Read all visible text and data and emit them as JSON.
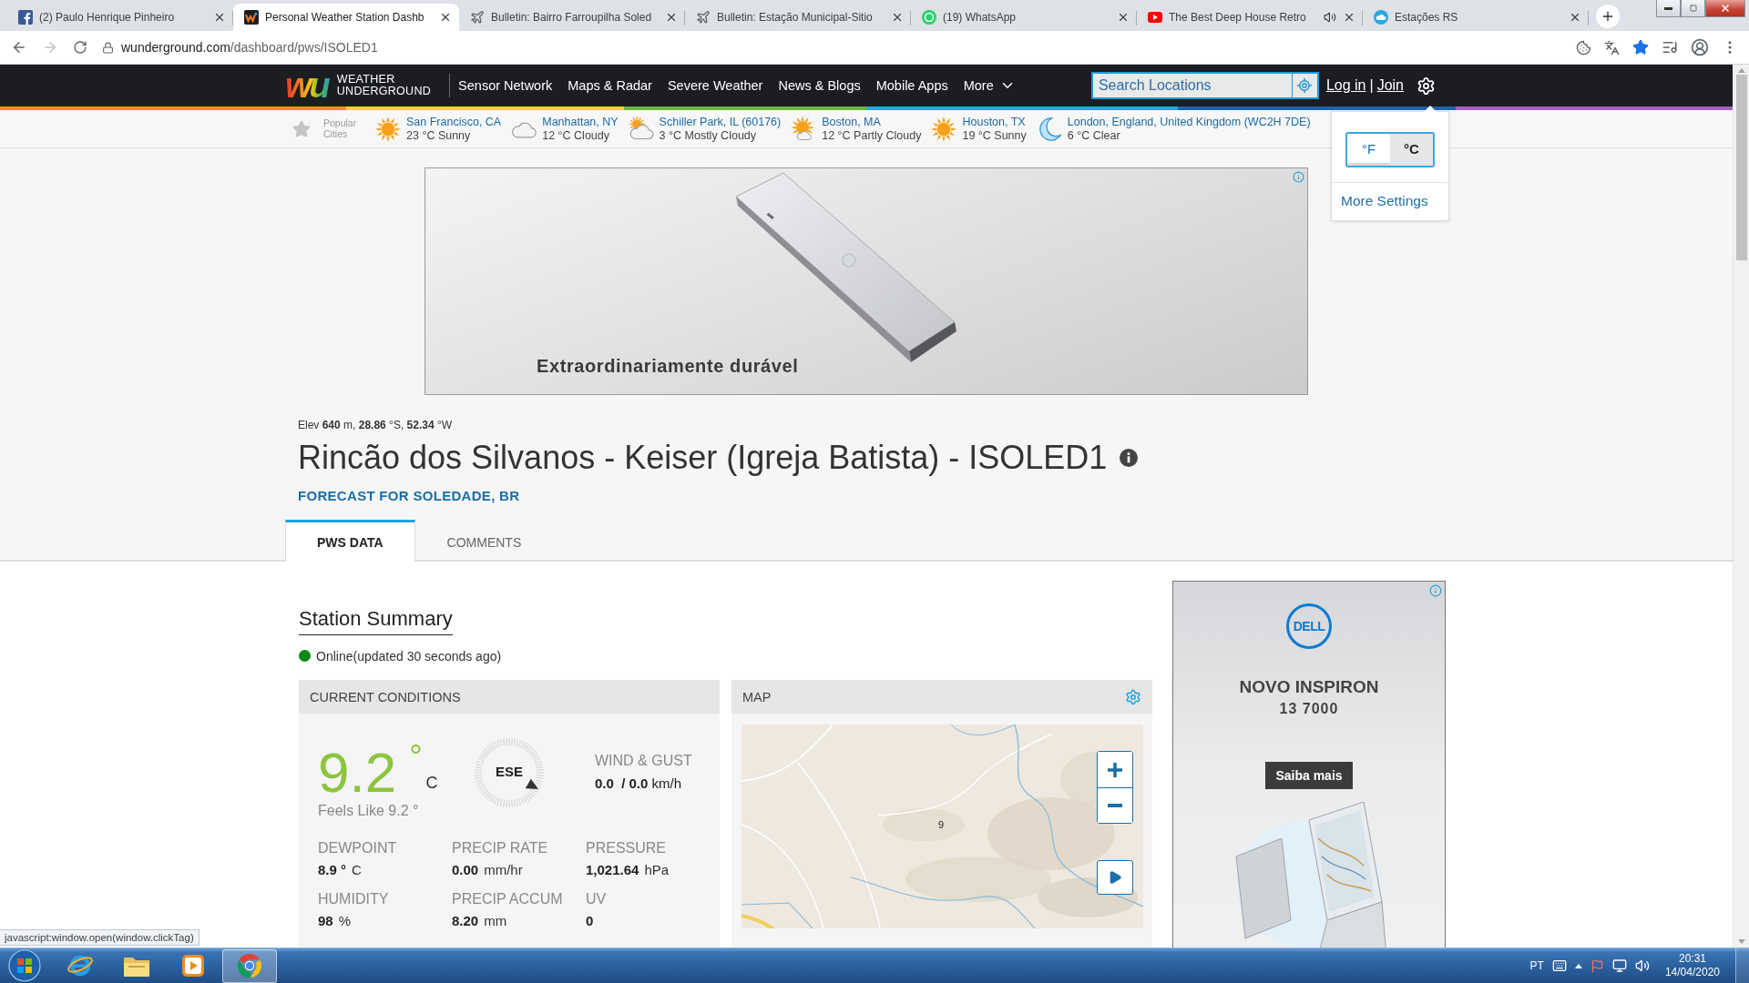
{
  "browser": {
    "tabs": [
      {
        "title": "(2) Paulo Henrique Pinheiro",
        "kind": "facebook",
        "audio": false,
        "selected": false
      },
      {
        "title": "Personal Weather Station Dashb",
        "kind": "wu",
        "audio": false,
        "selected": true
      },
      {
        "title": "Bulletin: Bairro Farroupilha Soled",
        "kind": "plane",
        "audio": false,
        "selected": false
      },
      {
        "title": "Bulletin: Estação Municipal-Sitio",
        "kind": "plane",
        "audio": false,
        "selected": false
      },
      {
        "title": "(19) WhatsApp",
        "kind": "whatsapp",
        "audio": false,
        "selected": false
      },
      {
        "title": "The Best Deep House Retro",
        "kind": "youtube",
        "audio": true,
        "selected": false
      },
      {
        "title": "Estações RS",
        "kind": "cloud",
        "audio": false,
        "selected": false
      }
    ],
    "url": {
      "host": "wunderground.com",
      "path": "/dashboard/pws/ISOLED1"
    }
  },
  "site_header": {
    "logo": {
      "mark": "wu",
      "line_1": "WEATHER",
      "line_2": "UNDERGROUND"
    },
    "nav": [
      {
        "label": "Sensor Network",
        "kind": "link"
      },
      {
        "label": "Maps & Radar",
        "kind": "link"
      },
      {
        "label": "Severe Weather",
        "kind": "link"
      },
      {
        "label": "News & Blogs",
        "kind": "link"
      },
      {
        "label": "Mobile Apps",
        "kind": "link"
      },
      {
        "label": "More",
        "kind": "menu"
      }
    ],
    "search": {
      "placeholder": "Search Locations"
    },
    "auth": {
      "login": "Log in",
      "separator": "|",
      "join": "Join"
    }
  },
  "popular_cities": {
    "label": "Popular Cities",
    "cities": [
      {
        "name": "San Francisco, CA",
        "conditions": "23 °C Sunny",
        "kind": "sunny"
      },
      {
        "name": "Manhattan, NY",
        "conditions": "12 °C Cloudy",
        "kind": "cloudy"
      },
      {
        "name": "Schiller Park, IL (60176)",
        "conditions": "3 °C Mostly Cloudy",
        "kind": "mostly-cloudy"
      },
      {
        "name": "Boston, MA",
        "conditions": "12 °C Partly Cloudy",
        "kind": "partly-cloudy"
      },
      {
        "name": "Houston, TX",
        "conditions": "19 °C Sunny",
        "kind": "sunny"
      },
      {
        "name": "London, England, United Kingdom (WC2H 7DE)",
        "conditions": "6 °C Clear",
        "kind": "clear-night"
      }
    ]
  },
  "settings_menu": {
    "units": [
      {
        "label": "°F",
        "selected": false
      },
      {
        "label": "°C",
        "selected": true
      }
    ],
    "link": "More Settings"
  },
  "top_ad": {
    "headline": "Extraordinariamente durável"
  },
  "station": {
    "elevation": "Elev **640** m, **28.86** °S, **52.34** °W",
    "title": "Rincão dos Silvanos - Keiser (Igreja Batista) - ISOLED1",
    "forecast_link": "FORECAST FOR SOLEDADE, BR"
  },
  "page_tabs": [
    {
      "label": "PWS DATA",
      "selected": true
    },
    {
      "label": "COMMENTS",
      "selected": false
    }
  ],
  "summary": {
    "heading": "Station Summary",
    "online": true,
    "status": "Online(updated 30 seconds ago)"
  },
  "current_conditions": {
    "heading": "CURRENT CONDITIONS",
    "temperature": "9.2",
    "degree": "°",
    "unit": "C",
    "feels_like": "Feels Like 9.2 °",
    "wind_direction": "ESE",
    "wind_label": "WIND & GUST",
    "wind_values": "0.0  / 0.0",
    "wind_unit": "km/h",
    "metrics": [
      {
        "label": "DEWPOINT",
        "value": "8.9 °",
        "unit": "C"
      },
      {
        "label": "PRECIP RATE",
        "value": "0.00",
        "unit": "mm/hr"
      },
      {
        "label": "PRESSURE",
        "value": "1,021.64",
        "unit": "hPa"
      },
      {
        "label": "HUMIDITY",
        "value": "98",
        "unit": "%"
      },
      {
        "label": "PRECIP ACCUM",
        "value": "8.20",
        "unit": "mm"
      },
      {
        "label": "UV",
        "value": "0"
      }
    ]
  },
  "map": {
    "heading": "MAP",
    "marker": "9"
  },
  "side_ad": {
    "logo": "DELL",
    "headline": "NOVO INSPIRON",
    "model": "13 7000",
    "button": "Saiba mais"
  },
  "status_url": "javascript:window.open(window.clickTag)",
  "taskbar": {
    "apps": [
      {
        "kind": "orbit",
        "selected": false
      },
      {
        "kind": "folder",
        "selected": false
      },
      {
        "kind": "player",
        "selected": false
      },
      {
        "kind": "chrome",
        "selected": true
      }
    ],
    "language": "PT",
    "time": "20:31",
    "date": "14/04/2020"
  }
}
